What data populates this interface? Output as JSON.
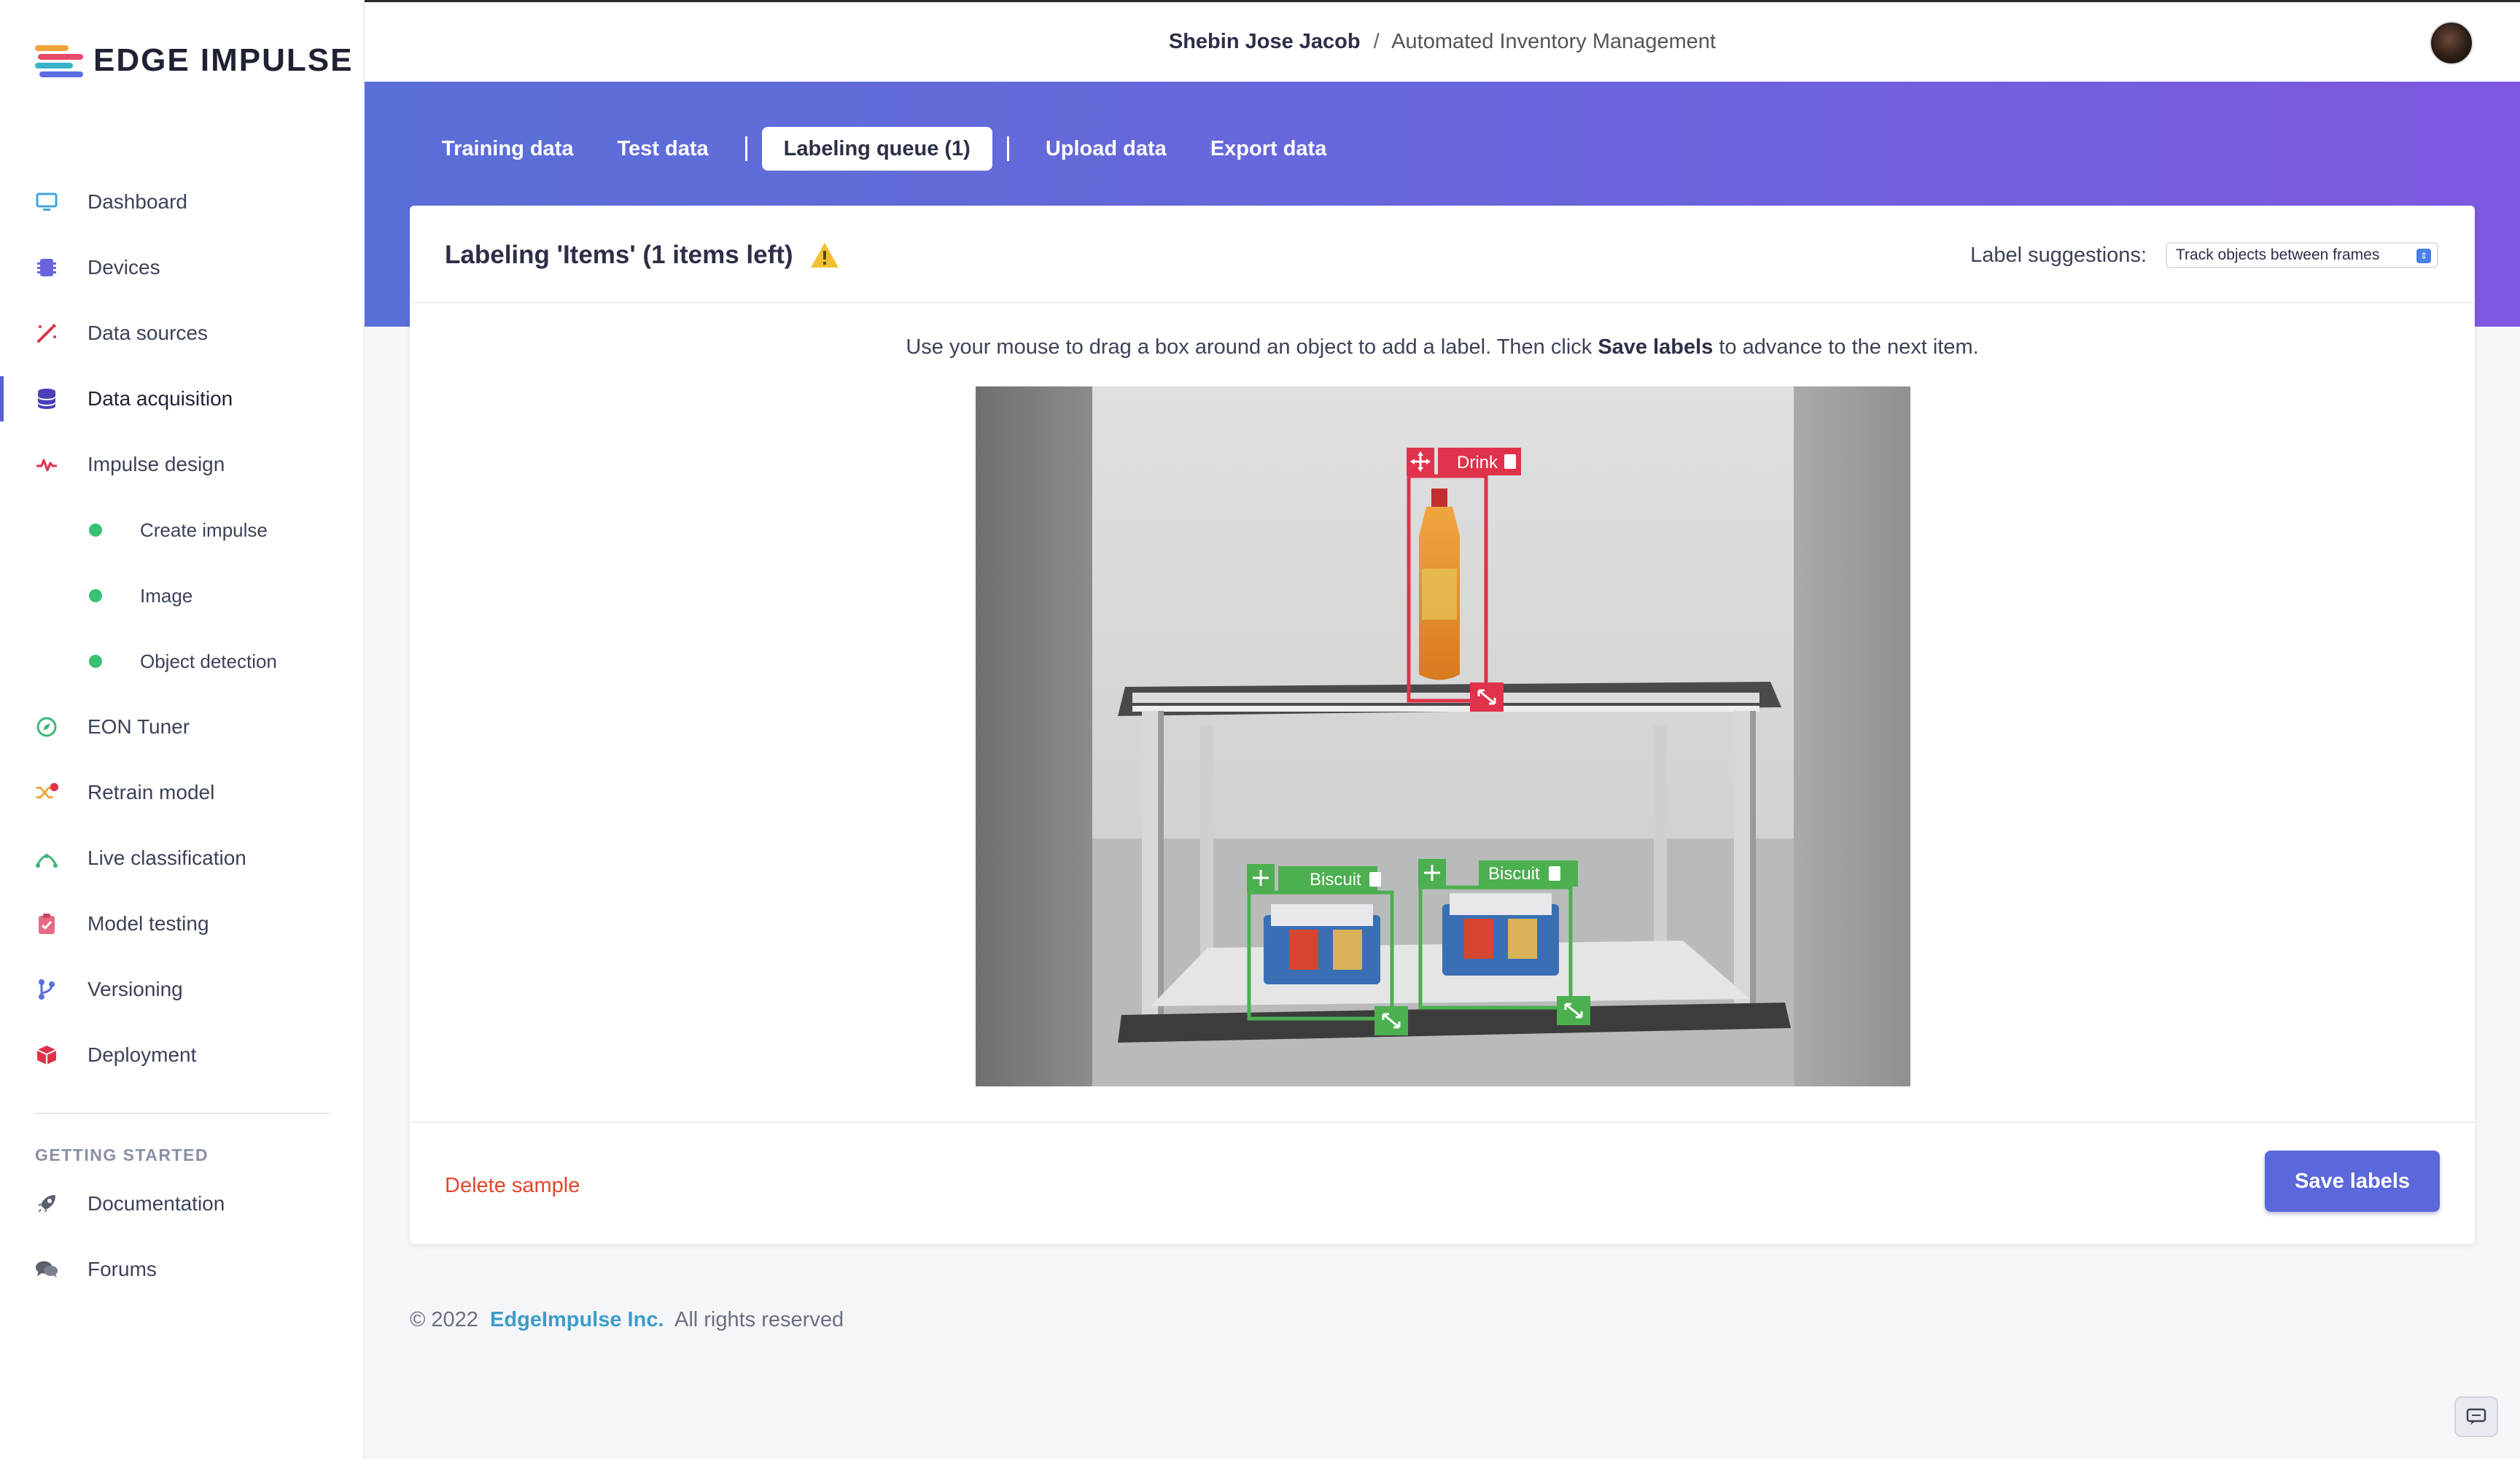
{
  "brand": {
    "name": "EDGE IMPULSE"
  },
  "sidebar": {
    "items": [
      {
        "label": "Dashboard",
        "icon": "monitor-icon"
      },
      {
        "label": "Devices",
        "icon": "chip-icon"
      },
      {
        "label": "Data sources",
        "icon": "wand-icon"
      },
      {
        "label": "Data acquisition",
        "icon": "database-icon",
        "active": true
      },
      {
        "label": "Impulse design",
        "icon": "pulse-icon"
      }
    ],
    "subitems": [
      {
        "label": "Create impulse"
      },
      {
        "label": "Image"
      },
      {
        "label": "Object detection"
      }
    ],
    "items2": [
      {
        "label": "EON Tuner",
        "icon": "compass-icon"
      },
      {
        "label": "Retrain model",
        "icon": "shuffle-icon"
      },
      {
        "label": "Live classification",
        "icon": "signal-icon"
      },
      {
        "label": "Model testing",
        "icon": "clipboard-check-icon"
      },
      {
        "label": "Versioning",
        "icon": "branch-icon"
      },
      {
        "label": "Deployment",
        "icon": "cube-icon"
      }
    ],
    "section_label": "GETTING STARTED",
    "help": [
      {
        "label": "Documentation",
        "icon": "rocket-icon"
      },
      {
        "label": "Forums",
        "icon": "chat-bubbles-icon"
      }
    ]
  },
  "topbar": {
    "owner": "Shebin Jose Jacob",
    "separator": "/",
    "project": "Automated Inventory Management"
  },
  "tabs": {
    "training": "Training data",
    "test": "Test data",
    "queue": "Labeling queue (1)",
    "upload": "Upload data",
    "export": "Export data"
  },
  "card": {
    "title": "Labeling 'Items' (1 items left)",
    "suggestions_label": "Label suggestions:",
    "suggestions_value": "Track objects between frames",
    "instruction_pre": "Use your mouse to drag a box around an object to add a label. Then click",
    "instruction_bold": "Save labels",
    "instruction_post": "to advance to the next item."
  },
  "boxes": [
    {
      "label": "Drink",
      "color": "#e0324b"
    },
    {
      "label": "Biscuit",
      "color": "#4caf50"
    },
    {
      "label": "Biscuit",
      "color": "#4caf50"
    }
  ],
  "actions": {
    "delete": "Delete sample",
    "save": "Save labels"
  },
  "footer": {
    "copyright": "© 2022",
    "company": "EdgeImpulse Inc.",
    "rights": "All rights reserved"
  },
  "colors": {
    "accent": "#5a68db",
    "danger": "#e0472b",
    "drink_box": "#e0324b",
    "biscuit_box": "#4caf50"
  }
}
